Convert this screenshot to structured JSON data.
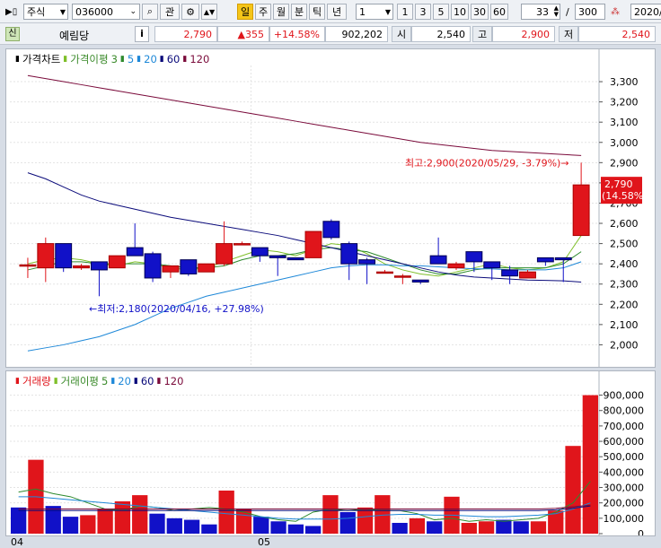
{
  "toolbar": {
    "market": "주식",
    "code": "036000",
    "watch_label": "관",
    "periods": [
      "일",
      "주",
      "월",
      "분",
      "틱",
      "년"
    ],
    "interval_value": "1",
    "nums": [
      "1",
      "3",
      "5",
      "10",
      "30",
      "60"
    ],
    "count_value": "33",
    "slash": "/",
    "total_value": "300",
    "date_value": "2020/"
  },
  "quote": {
    "tag": "신",
    "name": "예림당",
    "info_label": "i",
    "price": "2,790",
    "change": "▲355",
    "pct": "+14.58%",
    "volume": "902,202",
    "open_label": "시",
    "open": "2,540",
    "high_label": "고",
    "high": "2,900",
    "low_label": "저",
    "low": "2,540"
  },
  "price_legend": {
    "title": "가격차트",
    "ma_title": "가격이평",
    "ma": [
      "3",
      "5",
      "20",
      "60",
      "120"
    ]
  },
  "vol_legend": {
    "title": "거래량",
    "ma_title": "거래이평",
    "ma": [
      "5",
      "20",
      "60",
      "120"
    ]
  },
  "annotations": {
    "high": "최고:2,900(2020/05/29, -3.79%)→",
    "low": "←최저:2,180(2020/04/16, +27.98%)",
    "last_price": "2,790",
    "last_pct": "(14.58%)"
  },
  "colors": {
    "up": "#e0151b",
    "down": "#1111c8",
    "ma3": "#7fbf2a",
    "ma5": "#2d8a2d",
    "ma20": "#1e88d8",
    "ma60": "#0a0a7a",
    "ma120": "#7a0a3a"
  },
  "chart_data": [
    {
      "type": "candlestick",
      "title": "가격차트",
      "x_labels": [
        "04",
        "05"
      ],
      "y_ticks": [
        "3,300",
        "3,200",
        "3,100",
        "3,000",
        "2,900",
        "2,800",
        "2,700",
        "2,600",
        "2,500",
        "2,400",
        "2,300",
        "2,200",
        "2,100",
        "2,000"
      ],
      "ylim": [
        1900,
        3380
      ],
      "candles": [
        {
          "o": 2390,
          "h": 2430,
          "l": 2330,
          "c": 2395
        },
        {
          "o": 2380,
          "h": 2530,
          "l": 2310,
          "c": 2500
        },
        {
          "o": 2500,
          "h": 2500,
          "l": 2360,
          "c": 2380
        },
        {
          "o": 2380,
          "h": 2400,
          "l": 2370,
          "c": 2390
        },
        {
          "o": 2410,
          "h": 2410,
          "l": 2240,
          "c": 2370
        },
        {
          "o": 2380,
          "h": 2440,
          "l": 2380,
          "c": 2440
        },
        {
          "o": 2480,
          "h": 2600,
          "l": 2450,
          "c": 2440
        },
        {
          "o": 2450,
          "h": 2460,
          "l": 2310,
          "c": 2330
        },
        {
          "o": 2360,
          "h": 2390,
          "l": 2330,
          "c": 2390
        },
        {
          "o": 2420,
          "h": 2420,
          "l": 2340,
          "c": 2350
        },
        {
          "o": 2360,
          "h": 2400,
          "l": 2360,
          "c": 2400
        },
        {
          "o": 2400,
          "h": 2610,
          "l": 2390,
          "c": 2500
        },
        {
          "o": 2500,
          "h": 2510,
          "l": 2500,
          "c": 2500
        },
        {
          "o": 2480,
          "h": 2480,
          "l": 2410,
          "c": 2440
        },
        {
          "o": 2440,
          "h": 2440,
          "l": 2340,
          "c": 2430
        },
        {
          "o": 2430,
          "h": 2430,
          "l": 2420,
          "c": 2420
        },
        {
          "o": 2430,
          "h": 2560,
          "l": 2430,
          "c": 2560
        },
        {
          "o": 2610,
          "h": 2620,
          "l": 2520,
          "c": 2530
        },
        {
          "o": 2500,
          "h": 2510,
          "l": 2320,
          "c": 2400
        },
        {
          "o": 2420,
          "h": 2430,
          "l": 2300,
          "c": 2400
        },
        {
          "o": 2360,
          "h": 2370,
          "l": 2360,
          "c": 2360
        },
        {
          "o": 2340,
          "h": 2350,
          "l": 2300,
          "c": 2340
        },
        {
          "o": 2320,
          "h": 2320,
          "l": 2300,
          "c": 2310
        },
        {
          "o": 2440,
          "h": 2530,
          "l": 2410,
          "c": 2400
        },
        {
          "o": 2380,
          "h": 2410,
          "l": 2370,
          "c": 2400
        },
        {
          "o": 2460,
          "h": 2460,
          "l": 2360,
          "c": 2410
        },
        {
          "o": 2410,
          "h": 2410,
          "l": 2320,
          "c": 2380
        },
        {
          "o": 2370,
          "h": 2390,
          "l": 2300,
          "c": 2340
        },
        {
          "o": 2330,
          "h": 2370,
          "l": 2330,
          "c": 2360
        },
        {
          "o": 2430,
          "h": 2430,
          "l": 2390,
          "c": 2410
        },
        {
          "o": 2430,
          "h": 2430,
          "l": 2310,
          "c": 2420
        },
        {
          "o": 2540,
          "h": 2900,
          "l": 2540,
          "c": 2790
        }
      ],
      "ma": [
        {
          "name": "3",
          "values": [
            2400,
            2420,
            2430,
            2420,
            2400,
            2390,
            2410,
            2400,
            2380,
            2370,
            2380,
            2410,
            2440,
            2470,
            2460,
            2440,
            2470,
            2500,
            2490,
            2450,
            2400,
            2370,
            2350,
            2340,
            2360,
            2380,
            2400,
            2380,
            2370,
            2380,
            2410,
            2540
          ]
        },
        {
          "name": "5",
          "values": [
            2370,
            2390,
            2410,
            2410,
            2400,
            2400,
            2400,
            2400,
            2390,
            2380,
            2380,
            2390,
            2420,
            2440,
            2440,
            2450,
            2470,
            2480,
            2470,
            2460,
            2430,
            2400,
            2370,
            2350,
            2350,
            2370,
            2380,
            2380,
            2380,
            2380,
            2400,
            2460
          ]
        },
        {
          "name": "20",
          "values": [
            1970,
            1985,
            2000,
            2020,
            2040,
            2070,
            2100,
            2140,
            2180,
            2210,
            2240,
            2260,
            2280,
            2300,
            2320,
            2340,
            2360,
            2380,
            2390,
            2395,
            2395,
            2390,
            2390,
            2385,
            2380,
            2375,
            2375,
            2370,
            2370,
            2370,
            2380,
            2410
          ]
        },
        {
          "name": "60",
          "values": [
            2850,
            2820,
            2780,
            2740,
            2710,
            2690,
            2670,
            2650,
            2630,
            2615,
            2600,
            2585,
            2570,
            2555,
            2540,
            2520,
            2500,
            2480,
            2460,
            2440,
            2420,
            2400,
            2380,
            2360,
            2345,
            2335,
            2330,
            2325,
            2320,
            2318,
            2316,
            2310
          ]
        },
        {
          "name": "120",
          "values": [
            3330,
            3315,
            3300,
            3285,
            3270,
            3255,
            3240,
            3225,
            3210,
            3195,
            3180,
            3165,
            3150,
            3135,
            3120,
            3105,
            3090,
            3075,
            3060,
            3045,
            3030,
            3015,
            3000,
            2990,
            2980,
            2970,
            2960,
            2955,
            2950,
            2945,
            2940,
            2935
          ]
        }
      ]
    },
    {
      "type": "bar",
      "title": "거래량",
      "y_ticks": [
        "900,000",
        "800,000",
        "700,000",
        "600,000",
        "500,000",
        "400,000",
        "300,000",
        "200,000",
        "100,000",
        "0"
      ],
      "ylim": [
        0,
        950000
      ],
      "values": [
        170000,
        480000,
        180000,
        110000,
        120000,
        160000,
        210000,
        250000,
        130000,
        100000,
        90000,
        60000,
        280000,
        160000,
        110000,
        80000,
        60000,
        50000,
        250000,
        140000,
        170000,
        250000,
        70000,
        100000,
        80000,
        240000,
        70000,
        80000,
        90000,
        80000,
        80000,
        150000,
        570000,
        900000
      ],
      "directions": [
        "d",
        "u",
        "d",
        "d",
        "u",
        "u",
        "u",
        "u",
        "d",
        "d",
        "d",
        "d",
        "u",
        "u",
        "d",
        "d",
        "d",
        "d",
        "u",
        "d",
        "u",
        "u",
        "d",
        "u",
        "d",
        "u",
        "u",
        "u",
        "d",
        "d",
        "u",
        "u",
        "u",
        "u"
      ],
      "ma": [
        {
          "name": "5",
          "values": [
            270000,
            290000,
            260000,
            240000,
            200000,
            160000,
            150000,
            180000,
            170000,
            150000,
            160000,
            170000,
            160000,
            140000,
            110000,
            90000,
            80000,
            140000,
            160000,
            150000,
            160000,
            150000,
            150000,
            130000,
            90000,
            100000,
            80000,
            90000,
            80000,
            90000,
            100000,
            140000,
            200000,
            340000
          ]
        },
        {
          "name": "20",
          "values": [
            240000,
            240000,
            230000,
            220000,
            210000,
            200000,
            190000,
            180000,
            170000,
            160000,
            150000,
            140000,
            130000,
            120000,
            110000,
            100000,
            95000,
            95000,
            95000,
            100000,
            110000,
            120000,
            125000,
            125000,
            120000,
            120000,
            115000,
            110000,
            110000,
            115000,
            120000,
            130000,
            160000,
            200000
          ]
        },
        {
          "name": "60",
          "values": [
            150000,
            150000,
            150000,
            150000,
            150000,
            150000,
            150000,
            150000,
            150000,
            150000,
            150000,
            150000,
            150000,
            150000,
            150000,
            150000,
            150000,
            150000,
            150000,
            150000,
            150000,
            150000,
            150000,
            150000,
            150000,
            150000,
            150000,
            150000,
            150000,
            150000,
            150000,
            155000,
            165000,
            180000
          ]
        },
        {
          "name": "120",
          "values": [
            160000,
            160000,
            160000,
            160000,
            160000,
            160000,
            160000,
            160000,
            160000,
            160000,
            160000,
            160000,
            160000,
            160000,
            160000,
            160000,
            160000,
            160000,
            160000,
            160000,
            160000,
            160000,
            160000,
            160000,
            160000,
            160000,
            160000,
            160000,
            160000,
            160000,
            160000,
            165000,
            175000,
            185000
          ]
        }
      ]
    }
  ]
}
